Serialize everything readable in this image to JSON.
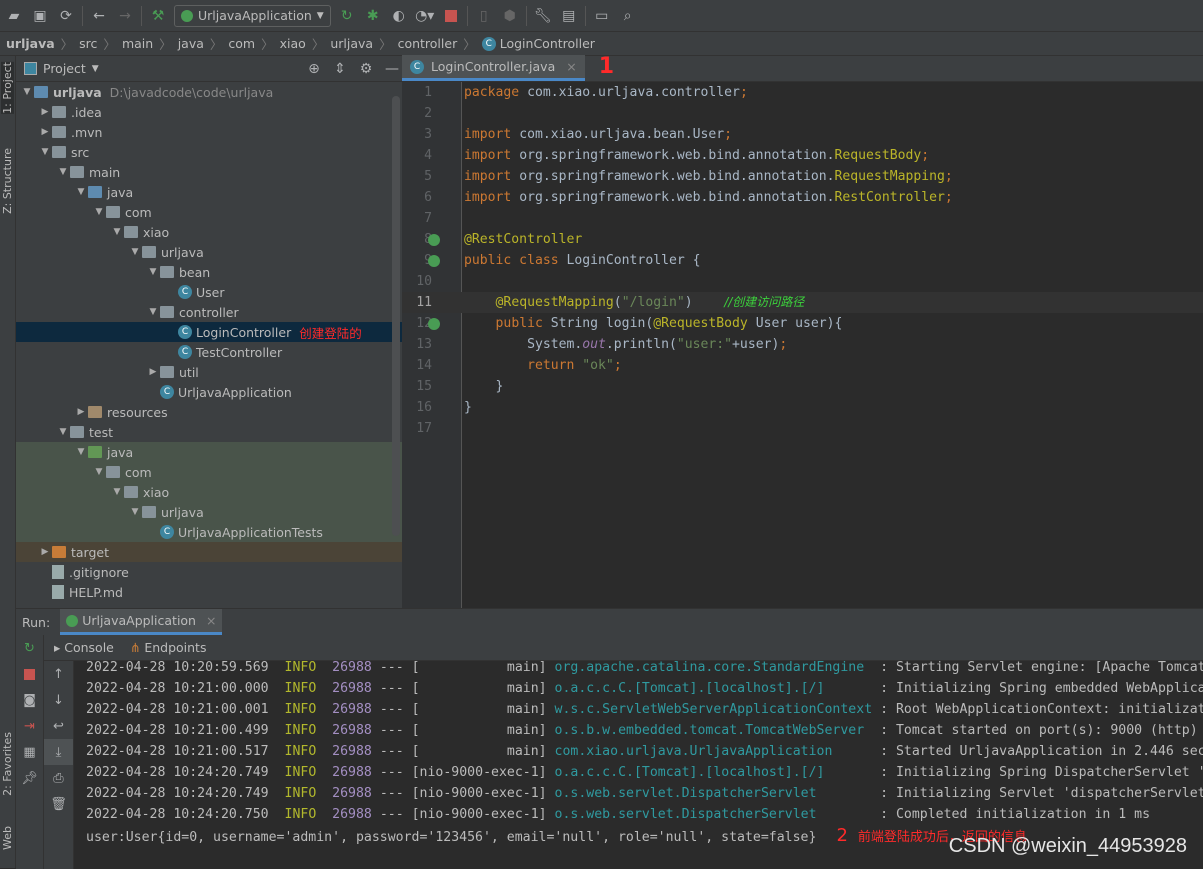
{
  "toolbar": {
    "run_config": "UrljavaApplication",
    "icons": [
      "open-folder-icon",
      "save-icon",
      "sync-icon",
      "back-icon",
      "forward-icon",
      "build-hammer-icon",
      "run-config-dropdown",
      "rerun-icon",
      "debug-icon",
      "coverage-icon",
      "profile-icon",
      "stop-icon",
      "device-icon",
      "deploy-icon",
      "settings-wrench-icon",
      "project-structure-icon",
      "run-anything-icon",
      "search-icon"
    ]
  },
  "breadcrumb": [
    "urljava",
    "src",
    "main",
    "java",
    "com",
    "xiao",
    "urljava",
    "controller",
    "LoginController"
  ],
  "left_strip": {
    "project": "1: Project",
    "structure": "Z: Structure",
    "favorites": "2: Favorites",
    "web": "Web"
  },
  "project_panel": {
    "title": "Project",
    "tree": [
      {
        "label": "urljava",
        "depth": 0,
        "arrow": "▼",
        "icon": "folder-blue",
        "path": "D:\\javadcode\\code\\urljava",
        "bold": true
      },
      {
        "label": ".idea",
        "depth": 1,
        "arrow": "▶",
        "icon": "folder"
      },
      {
        "label": ".mvn",
        "depth": 1,
        "arrow": "▶",
        "icon": "folder"
      },
      {
        "label": "src",
        "depth": 1,
        "arrow": "▼",
        "icon": "folder"
      },
      {
        "label": "main",
        "depth": 2,
        "arrow": "▼",
        "icon": "folder"
      },
      {
        "label": "java",
        "depth": 3,
        "arrow": "▼",
        "icon": "folder-blue"
      },
      {
        "label": "com",
        "depth": 4,
        "arrow": "▼",
        "icon": "folder"
      },
      {
        "label": "xiao",
        "depth": 5,
        "arrow": "▼",
        "icon": "folder"
      },
      {
        "label": "urljava",
        "depth": 6,
        "arrow": "▼",
        "icon": "folder"
      },
      {
        "label": "bean",
        "depth": 7,
        "arrow": "▼",
        "icon": "folder"
      },
      {
        "label": "User",
        "depth": 8,
        "arrow": "",
        "icon": "class"
      },
      {
        "label": "controller",
        "depth": 7,
        "arrow": "▼",
        "icon": "folder"
      },
      {
        "label": "LoginController",
        "depth": 8,
        "arrow": "",
        "icon": "class",
        "selected": true,
        "note": "创建登陆的"
      },
      {
        "label": "TestController",
        "depth": 8,
        "arrow": "",
        "icon": "class"
      },
      {
        "label": "util",
        "depth": 7,
        "arrow": "▶",
        "icon": "folder"
      },
      {
        "label": "UrljavaApplication",
        "depth": 7,
        "arrow": "",
        "icon": "class"
      },
      {
        "label": "resources",
        "depth": 3,
        "arrow": "▶",
        "icon": "folder-res"
      },
      {
        "label": "test",
        "depth": 2,
        "arrow": "▼",
        "icon": "folder"
      },
      {
        "label": "java",
        "depth": 3,
        "arrow": "▼",
        "icon": "folder-green",
        "test": true
      },
      {
        "label": "com",
        "depth": 4,
        "arrow": "▼",
        "icon": "folder",
        "test": true
      },
      {
        "label": "xiao",
        "depth": 5,
        "arrow": "▼",
        "icon": "folder",
        "test": true
      },
      {
        "label": "urljava",
        "depth": 6,
        "arrow": "▼",
        "icon": "folder",
        "test": true
      },
      {
        "label": "UrljavaApplicationTests",
        "depth": 7,
        "arrow": "",
        "icon": "class",
        "test": true
      },
      {
        "label": "target",
        "depth": 1,
        "arrow": "▶",
        "icon": "folder-orange",
        "target": true
      },
      {
        "label": ".gitignore",
        "depth": 1,
        "arrow": "",
        "icon": "file"
      },
      {
        "label": "HELP.md",
        "depth": 1,
        "arrow": "",
        "icon": "file"
      }
    ]
  },
  "editor": {
    "tab_label": "LoginController.java",
    "tab_annotation": "1",
    "lines": [
      [
        [
          "kw",
          "package "
        ],
        [
          "tx",
          "com.xiao.urljava.controller"
        ],
        [
          "kw",
          ";"
        ]
      ],
      [],
      [
        [
          "kw",
          "import "
        ],
        [
          "tx",
          "com.xiao.urljava.bean.User"
        ],
        [
          "kw",
          ";"
        ]
      ],
      [
        [
          "kw",
          "import "
        ],
        [
          "tx",
          "org.springframework.web.bind.annotation."
        ],
        [
          "an",
          "RequestBody"
        ],
        [
          "kw",
          ";"
        ]
      ],
      [
        [
          "kw",
          "import "
        ],
        [
          "tx",
          "org.springframework.web.bind.annotation."
        ],
        [
          "an",
          "RequestMapping"
        ],
        [
          "kw",
          ";"
        ]
      ],
      [
        [
          "kw",
          "import "
        ],
        [
          "tx",
          "org.springframework.web.bind.annotation."
        ],
        [
          "an",
          "RestController"
        ],
        [
          "kw",
          ";"
        ]
      ],
      [],
      [
        [
          "an",
          "@RestController"
        ]
      ],
      [
        [
          "kw",
          "public class "
        ],
        [
          "tx",
          "LoginController {"
        ]
      ],
      [],
      [
        [
          "tx",
          "    "
        ],
        [
          "an",
          "@RequestMapping"
        ],
        [
          "tx",
          "("
        ],
        [
          "st",
          "\"/login\""
        ],
        [
          "tx",
          ")    "
        ],
        [
          "cnote",
          "//创建访问路径"
        ]
      ],
      [
        [
          "tx",
          "    "
        ],
        [
          "kw",
          "public "
        ],
        [
          "tx",
          "String login("
        ],
        [
          "an",
          "@RequestBody "
        ],
        [
          "tx",
          "User user){"
        ]
      ],
      [
        [
          "tx",
          "        System."
        ],
        [
          "it",
          "out"
        ],
        [
          "tx",
          ".println("
        ],
        [
          "st",
          "\"user:\""
        ],
        [
          "tx",
          "+user)"
        ],
        [
          "kw",
          ";"
        ]
      ],
      [
        [
          "tx",
          "        "
        ],
        [
          "kw",
          "return "
        ],
        [
          "st",
          "\"ok\""
        ],
        [
          "kw",
          ";"
        ]
      ],
      [
        [
          "tx",
          "    }"
        ]
      ],
      [
        [
          "tx",
          "}"
        ]
      ],
      []
    ],
    "current_line": 11,
    "gutter_icons": [
      8,
      9,
      12
    ]
  },
  "run": {
    "label": "Run:",
    "config": "UrljavaApplication",
    "tabs": [
      "Console",
      "Endpoints"
    ],
    "logs": [
      {
        "ts": "2022-04-28 10:20:59.569",
        "level": "INFO",
        "pid": "26988",
        "sep": "---",
        "thread": "[           main]",
        "logger": "org.apache.catalina.core.StandardEngine ",
        "msg": ": Starting Servlet engine: [Apache Tomcat"
      },
      {
        "ts": "2022-04-28 10:21:00.000",
        "level": "INFO",
        "pid": "26988",
        "sep": "---",
        "thread": "[           main]",
        "logger": "o.a.c.c.C.[Tomcat].[localhost].[/]      ",
        "msg": ": Initializing Spring embedded WebApplica"
      },
      {
        "ts": "2022-04-28 10:21:00.001",
        "level": "INFO",
        "pid": "26988",
        "sep": "---",
        "thread": "[           main]",
        "logger": "w.s.c.ServletWebServerApplicationContext",
        "msg": ": Root WebApplicationContext: initializat"
      },
      {
        "ts": "2022-04-28 10:21:00.499",
        "level": "INFO",
        "pid": "26988",
        "sep": "---",
        "thread": "[           main]",
        "logger": "o.s.b.w.embedded.tomcat.TomcatWebServer ",
        "msg": ": Tomcat started on port(s): 9000 (http)"
      },
      {
        "ts": "2022-04-28 10:21:00.517",
        "level": "INFO",
        "pid": "26988",
        "sep": "---",
        "thread": "[           main]",
        "logger": "com.xiao.urljava.UrljavaApplication     ",
        "msg": ": Started UrljavaApplication in 2.446 sec"
      },
      {
        "ts": "2022-04-28 10:24:20.749",
        "level": "INFO",
        "pid": "26988",
        "sep": "---",
        "thread": "[nio-9000-exec-1]",
        "logger": "o.a.c.c.C.[Tomcat].[localhost].[/]      ",
        "msg": ": Initializing Spring DispatcherServlet '"
      },
      {
        "ts": "2022-04-28 10:24:20.749",
        "level": "INFO",
        "pid": "26988",
        "sep": "---",
        "thread": "[nio-9000-exec-1]",
        "logger": "o.s.web.servlet.DispatcherServlet       ",
        "msg": ": Initializing Servlet 'dispatcherServlet"
      },
      {
        "ts": "2022-04-28 10:24:20.750",
        "level": "INFO",
        "pid": "26988",
        "sep": "---",
        "thread": "[nio-9000-exec-1]",
        "logger": "o.s.web.servlet.DispatcherServlet       ",
        "msg": ": Completed initialization in 1 ms"
      }
    ],
    "output": "user:User{id=0, username='admin', password='123456', email='null', role='null', state=false}",
    "annotation_mark": "2",
    "annotation": "前端登陆成功后，返回的信息"
  },
  "watermark": "CSDN @weixin_44953928"
}
